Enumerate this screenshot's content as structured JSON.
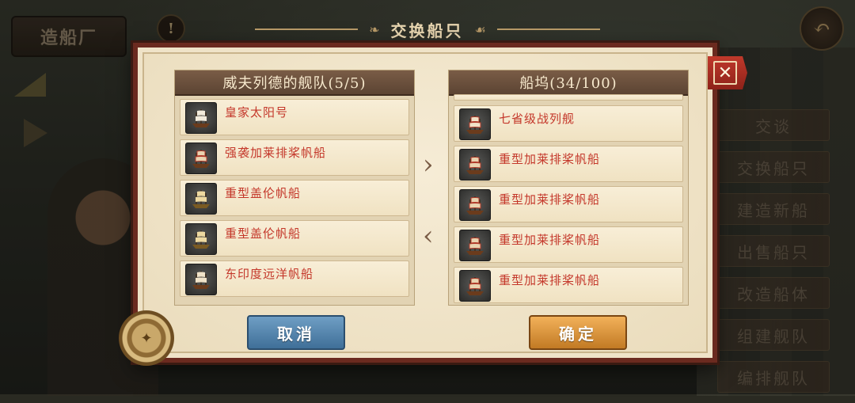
{
  "background": {
    "shipyard_label": "造船厂",
    "alert_icon": "exclamation-icon",
    "back_icon": "return-arrow-icon",
    "side_menu": [
      "交谈",
      "交换船只",
      "建造新船",
      "出售船只",
      "改造船体",
      "组建舰队",
      "编排舰队"
    ]
  },
  "dialog": {
    "title": "交换船只",
    "close_icon": "close-x-icon",
    "fleet_panel": {
      "header": "威夫列德的舰队(5/5)",
      "ships": [
        {
          "name": "皇家太阳号",
          "icon": "ship-icon"
        },
        {
          "name": "强袭加莱排桨帆船",
          "icon": "ship-icon"
        },
        {
          "name": "重型盖伦帆船",
          "icon": "ship-icon"
        },
        {
          "name": "重型盖伦帆船",
          "icon": "ship-icon"
        },
        {
          "name": "东印度远洋帆船",
          "icon": "ship-icon"
        }
      ]
    },
    "dock_panel": {
      "header": "船坞(34/100)",
      "ships": [
        {
          "name": "七省级战列舰",
          "icon": "ship-icon"
        },
        {
          "name": "重型加莱排桨帆船",
          "icon": "ship-icon"
        },
        {
          "name": "重型加莱排桨帆船",
          "icon": "ship-icon"
        },
        {
          "name": "重型加莱排桨帆船",
          "icon": "ship-icon"
        },
        {
          "name": "重型加莱排桨帆船",
          "icon": "ship-icon"
        }
      ]
    },
    "arrow_right": "›",
    "arrow_left": "‹",
    "cancel_label": "取消",
    "confirm_label": "确定"
  },
  "colors": {
    "frame": "#6b2a1f",
    "parchment": "#efe3c8",
    "ship_name": "#c4372a",
    "cancel": "#4f80aa",
    "confirm": "#e39a3c"
  }
}
